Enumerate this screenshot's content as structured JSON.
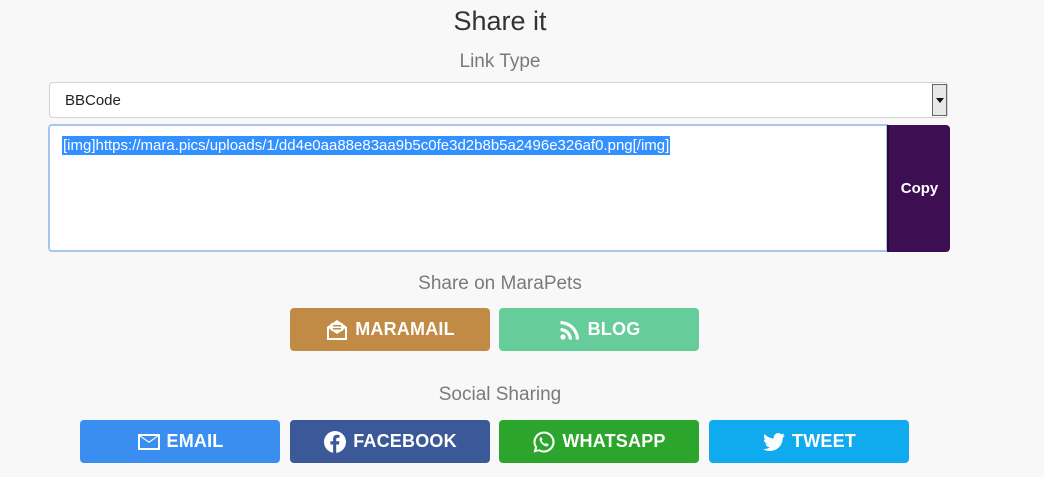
{
  "header": {
    "title": "Share it",
    "link_type_label": "Link Type"
  },
  "link_select": {
    "value": "BBCode"
  },
  "code": {
    "text": "[img]https://mara.pics/uploads/1/dd4e0aa88e83aa9b5c0fe3d2b8b5a2496e326af0.png[/img]",
    "selection_color": "#3390ff"
  },
  "copy_button": {
    "label": "Copy",
    "color": "#3d0f52"
  },
  "marapets": {
    "heading": "Share on MaraPets",
    "buttons": [
      {
        "label": "MARAMAIL",
        "icon": "mail-envelope-icon",
        "color": "#c18a45"
      },
      {
        "label": "BLOG",
        "icon": "rss-icon",
        "color": "#66cc99"
      }
    ]
  },
  "social": {
    "heading": "Social Sharing",
    "buttons": [
      {
        "label": "EMAIL",
        "icon": "envelope-icon",
        "color": "#3a8ef0"
      },
      {
        "label": "FACEBOOK",
        "icon": "facebook-icon",
        "color": "#3b5998"
      },
      {
        "label": "WHATSAPP",
        "icon": "whatsapp-icon",
        "color": "#2ba52b"
      },
      {
        "label": "TWEET",
        "icon": "twitter-icon",
        "color": "#10aaee"
      }
    ]
  }
}
